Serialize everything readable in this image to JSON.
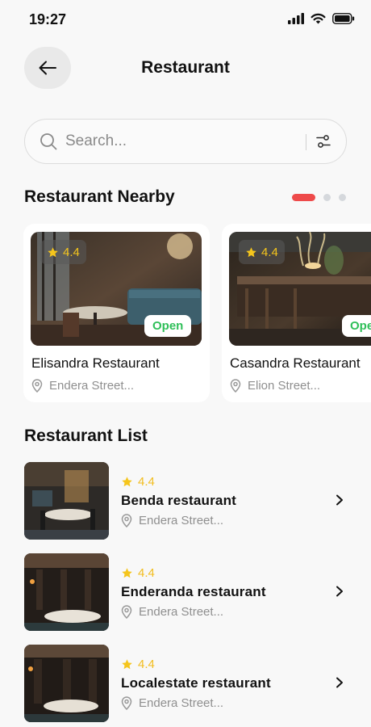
{
  "status_bar": {
    "time": "19:27",
    "icons": [
      "signal-icon",
      "wifi-icon",
      "battery-icon"
    ]
  },
  "header": {
    "title": "Restaurant",
    "back_icon": "arrow-left-icon"
  },
  "search": {
    "placeholder": "Search...",
    "value": "",
    "filter_icon": "sliders-icon"
  },
  "nearby": {
    "title": "Restaurant Nearby",
    "pager": {
      "total": 3,
      "active": 1,
      "active_color": "#ee4a4a"
    },
    "cards": [
      {
        "rating": "4.4",
        "status": "Open",
        "name": "Elisandra Restaurant",
        "location": "Endera Street..."
      },
      {
        "rating": "4.4",
        "status": "Open",
        "name": "Casandra Restaurant",
        "location": "Elion Street..."
      }
    ]
  },
  "list": {
    "title": "Restaurant List",
    "items": [
      {
        "rating": "4.4",
        "name": "Benda restaurant",
        "location": "Endera Street..."
      },
      {
        "rating": "4.4",
        "name": "Enderanda restaurant",
        "location": "Endera Street..."
      },
      {
        "rating": "4.4",
        "name": "Localestate restaurant",
        "location": "Endera Street..."
      }
    ]
  },
  "colors": {
    "accent": "#ee4a4a",
    "star": "#f5c51c",
    "open": "#2fbf59",
    "muted": "#8f8f8f"
  }
}
